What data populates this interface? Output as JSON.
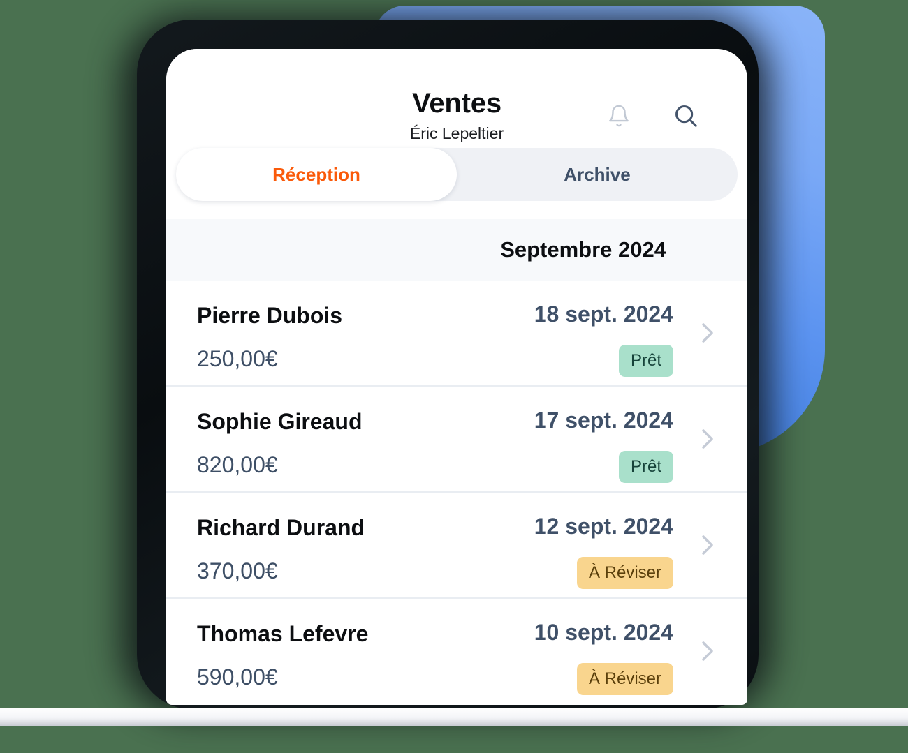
{
  "theme": {
    "page_background": "#4a7150",
    "accent_orange": "#fa5a0a",
    "slab_blue": "#5b93f0",
    "badge_ready_bg": "#a9e0cb",
    "badge_ready_fg": "#16433a",
    "badge_review_bg": "#f9d58e",
    "badge_review_fg": "#5b400c",
    "slate_text": "#3f5068"
  },
  "header": {
    "title": "Ventes",
    "subtitle": "Éric Lepeltier",
    "notifications_icon": "bell-icon",
    "search_icon": "search-icon"
  },
  "tabs": [
    {
      "label": "Réception",
      "active": true
    },
    {
      "label": "Archive",
      "active": false
    }
  ],
  "section": {
    "month_label": "Septembre 2024"
  },
  "rows": [
    {
      "name": "Pierre Dubois",
      "amount": "250,00€",
      "date": "18 sept. 2024",
      "status": "Prêt",
      "status_kind": "ready",
      "chevron": "chevron-right-icon"
    },
    {
      "name": "Sophie Gireaud",
      "amount": "820,00€",
      "date": "17 sept. 2024",
      "status": "Prêt",
      "status_kind": "ready",
      "chevron": "chevron-right-icon"
    },
    {
      "name": "Richard Durand",
      "amount": "370,00€",
      "date": "12 sept. 2024",
      "status": "À Réviser",
      "status_kind": "review",
      "chevron": "chevron-right-icon"
    },
    {
      "name": "Thomas Lefevre",
      "amount": "590,00€",
      "date": "10 sept. 2024",
      "status": "À Réviser",
      "status_kind": "review",
      "chevron": "chevron-right-icon"
    }
  ]
}
